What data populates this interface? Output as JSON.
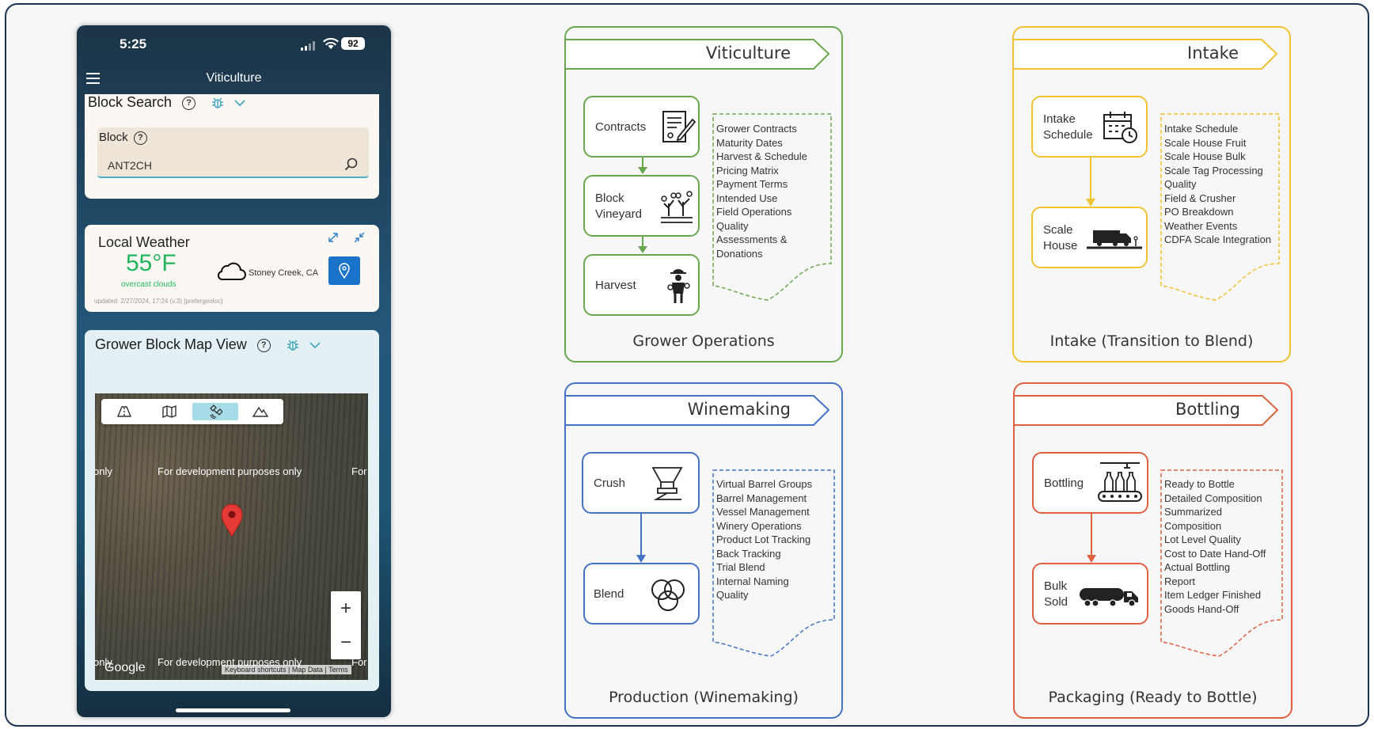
{
  "phone": {
    "time": "5:25",
    "battery": "92",
    "nav_title": "Viticulture",
    "block_search": {
      "title": "Block Search",
      "field_label": "Block",
      "value": "ANT2CH"
    },
    "weather": {
      "title": "Local Weather",
      "temp": "55°F",
      "desc": "overcast clouds",
      "location": "Stoney Creek, CA",
      "updated": "updated: 2/27/2024, 17:24  (v.3)   [prefergeoloc]"
    },
    "map_view": {
      "title": "Grower Block Map View",
      "dev_text": "For development purposes only",
      "dev_left": "only",
      "dev_right": "For",
      "google": "Google",
      "attribution": "Keyboard shortcuts  |  Map Data  |  Terms",
      "zoom_in": "+",
      "zoom_out": "−"
    }
  },
  "panels": {
    "grower": {
      "title": "Viticulture",
      "footer": "Grower Operations",
      "color": "#6aa84f",
      "nodes": [
        "Contracts",
        "Block\nVineyard",
        "Harvest"
      ],
      "items": [
        "Grower Contracts",
        "Maturity Dates",
        "Harvest & Schedule",
        "Pricing Matrix",
        "Payment Terms",
        "Intended Use",
        "Field Operations",
        "Quality",
        "Assessments &",
        "Donations"
      ]
    },
    "intake": {
      "title": "Intake",
      "footer": "Intake (Transition to Blend)",
      "color": "#f1c232",
      "nodes": [
        "Intake\nSchedule",
        "Scale\nHouse"
      ],
      "items": [
        "Intake Schedule",
        "Scale House Fruit",
        "Scale House Bulk",
        "Scale Tag Processing",
        "Quality",
        "Field & Crusher",
        "PO Breakdown",
        "Weather Events",
        "CDFA Scale Integration"
      ]
    },
    "production": {
      "title": "Winemaking",
      "footer": "Production (Winemaking)",
      "color": "#4472c4",
      "nodes": [
        "Crush",
        "Blend"
      ],
      "items": [
        "Virtual Barrel Groups",
        "Barrel Management",
        "Vessel Management",
        "Winery Operations",
        "Product Lot Tracking",
        "Back Tracking",
        "Trial Blend",
        "Internal Naming",
        "Quality"
      ]
    },
    "packaging": {
      "title": "Bottling",
      "footer": "Packaging (Ready to Bottle)",
      "color": "#e06040",
      "nodes": [
        "Bottling",
        "Bulk\nSold"
      ],
      "items": [
        "Ready to Bottle",
        "Detailed Composition",
        "Summarized",
        "Composition",
        "Lot Level Quality",
        "Cost to Date Hand-Off",
        "Actual Bottling",
        "Report",
        "Item Ledger Finished",
        "Goods Hand-Off"
      ]
    }
  }
}
